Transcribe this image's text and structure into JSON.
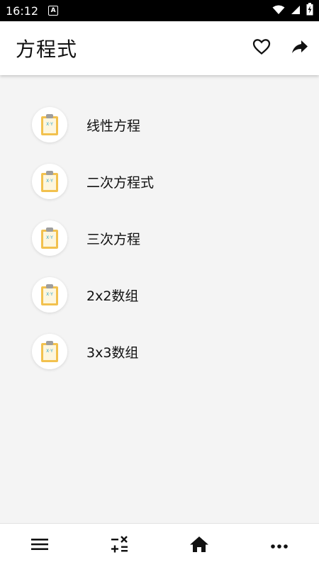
{
  "status_bar": {
    "time": "16:12",
    "notification_icon": "a-letter-icon",
    "icons": [
      "wifi-icon",
      "signal-icon",
      "battery-charging-icon"
    ]
  },
  "app_bar": {
    "title": "方程式",
    "actions": [
      "favorite-heart-icon",
      "share-icon"
    ]
  },
  "list": {
    "items": [
      {
        "label": "线性方程",
        "icon": "clipboard-xy-icon"
      },
      {
        "label": "二次方程式",
        "icon": "clipboard-xy-icon"
      },
      {
        "label": "三次方程",
        "icon": "clipboard-xy-icon"
      },
      {
        "label": "2x2数组",
        "icon": "clipboard-xy-icon"
      },
      {
        "label": "3x3数组",
        "icon": "clipboard-xy-icon"
      }
    ]
  },
  "bottom_nav": {
    "items": [
      "menu-icon",
      "calculator-operations-icon",
      "home-icon",
      "more-dots-icon"
    ]
  },
  "colors": {
    "clipboard": "#f2c14e",
    "clip": "#9e9e9e",
    "xy_text": "#2fa3c9",
    "background": "#f4f4f4"
  }
}
